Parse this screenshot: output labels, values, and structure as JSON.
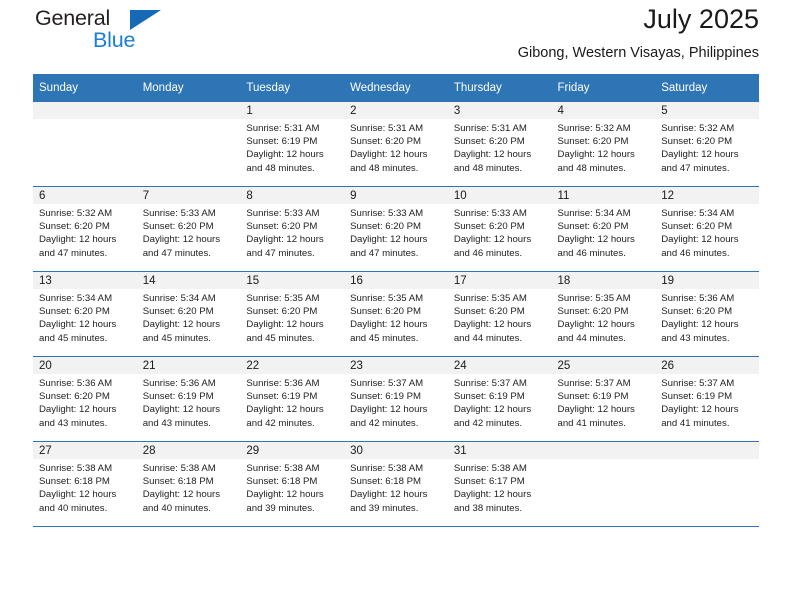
{
  "brand": {
    "name_top": "General",
    "name_bottom": "Blue",
    "triangle_icon": "triangle-icon",
    "accent_color": "#1a7fd4",
    "triangle_color": "#1669b5"
  },
  "header": {
    "title": "July 2025",
    "subtitle": "Gibong, Western Visayas, Philippines"
  },
  "theme": {
    "header_blue": "#2e75b6",
    "daynum_band": "#f2f2f2",
    "text": "#1a1a1a"
  },
  "weekday_headers": [
    "Sunday",
    "Monday",
    "Tuesday",
    "Wednesday",
    "Thursday",
    "Friday",
    "Saturday"
  ],
  "weeks": [
    [
      {
        "day": "",
        "sunrise": "",
        "sunset": "",
        "daylight_1": "",
        "daylight_2": ""
      },
      {
        "day": "",
        "sunrise": "",
        "sunset": "",
        "daylight_1": "",
        "daylight_2": ""
      },
      {
        "day": "1",
        "sunrise": "Sunrise: 5:31 AM",
        "sunset": "Sunset: 6:19 PM",
        "daylight_1": "Daylight: 12 hours",
        "daylight_2": "and 48 minutes."
      },
      {
        "day": "2",
        "sunrise": "Sunrise: 5:31 AM",
        "sunset": "Sunset: 6:20 PM",
        "daylight_1": "Daylight: 12 hours",
        "daylight_2": "and 48 minutes."
      },
      {
        "day": "3",
        "sunrise": "Sunrise: 5:31 AM",
        "sunset": "Sunset: 6:20 PM",
        "daylight_1": "Daylight: 12 hours",
        "daylight_2": "and 48 minutes."
      },
      {
        "day": "4",
        "sunrise": "Sunrise: 5:32 AM",
        "sunset": "Sunset: 6:20 PM",
        "daylight_1": "Daylight: 12 hours",
        "daylight_2": "and 48 minutes."
      },
      {
        "day": "5",
        "sunrise": "Sunrise: 5:32 AM",
        "sunset": "Sunset: 6:20 PM",
        "daylight_1": "Daylight: 12 hours",
        "daylight_2": "and 47 minutes."
      }
    ],
    [
      {
        "day": "6",
        "sunrise": "Sunrise: 5:32 AM",
        "sunset": "Sunset: 6:20 PM",
        "daylight_1": "Daylight: 12 hours",
        "daylight_2": "and 47 minutes."
      },
      {
        "day": "7",
        "sunrise": "Sunrise: 5:33 AM",
        "sunset": "Sunset: 6:20 PM",
        "daylight_1": "Daylight: 12 hours",
        "daylight_2": "and 47 minutes."
      },
      {
        "day": "8",
        "sunrise": "Sunrise: 5:33 AM",
        "sunset": "Sunset: 6:20 PM",
        "daylight_1": "Daylight: 12 hours",
        "daylight_2": "and 47 minutes."
      },
      {
        "day": "9",
        "sunrise": "Sunrise: 5:33 AM",
        "sunset": "Sunset: 6:20 PM",
        "daylight_1": "Daylight: 12 hours",
        "daylight_2": "and 47 minutes."
      },
      {
        "day": "10",
        "sunrise": "Sunrise: 5:33 AM",
        "sunset": "Sunset: 6:20 PM",
        "daylight_1": "Daylight: 12 hours",
        "daylight_2": "and 46 minutes."
      },
      {
        "day": "11",
        "sunrise": "Sunrise: 5:34 AM",
        "sunset": "Sunset: 6:20 PM",
        "daylight_1": "Daylight: 12 hours",
        "daylight_2": "and 46 minutes."
      },
      {
        "day": "12",
        "sunrise": "Sunrise: 5:34 AM",
        "sunset": "Sunset: 6:20 PM",
        "daylight_1": "Daylight: 12 hours",
        "daylight_2": "and 46 minutes."
      }
    ],
    [
      {
        "day": "13",
        "sunrise": "Sunrise: 5:34 AM",
        "sunset": "Sunset: 6:20 PM",
        "daylight_1": "Daylight: 12 hours",
        "daylight_2": "and 45 minutes."
      },
      {
        "day": "14",
        "sunrise": "Sunrise: 5:34 AM",
        "sunset": "Sunset: 6:20 PM",
        "daylight_1": "Daylight: 12 hours",
        "daylight_2": "and 45 minutes."
      },
      {
        "day": "15",
        "sunrise": "Sunrise: 5:35 AM",
        "sunset": "Sunset: 6:20 PM",
        "daylight_1": "Daylight: 12 hours",
        "daylight_2": "and 45 minutes."
      },
      {
        "day": "16",
        "sunrise": "Sunrise: 5:35 AM",
        "sunset": "Sunset: 6:20 PM",
        "daylight_1": "Daylight: 12 hours",
        "daylight_2": "and 45 minutes."
      },
      {
        "day": "17",
        "sunrise": "Sunrise: 5:35 AM",
        "sunset": "Sunset: 6:20 PM",
        "daylight_1": "Daylight: 12 hours",
        "daylight_2": "and 44 minutes."
      },
      {
        "day": "18",
        "sunrise": "Sunrise: 5:35 AM",
        "sunset": "Sunset: 6:20 PM",
        "daylight_1": "Daylight: 12 hours",
        "daylight_2": "and 44 minutes."
      },
      {
        "day": "19",
        "sunrise": "Sunrise: 5:36 AM",
        "sunset": "Sunset: 6:20 PM",
        "daylight_1": "Daylight: 12 hours",
        "daylight_2": "and 43 minutes."
      }
    ],
    [
      {
        "day": "20",
        "sunrise": "Sunrise: 5:36 AM",
        "sunset": "Sunset: 6:20 PM",
        "daylight_1": "Daylight: 12 hours",
        "daylight_2": "and 43 minutes."
      },
      {
        "day": "21",
        "sunrise": "Sunrise: 5:36 AM",
        "sunset": "Sunset: 6:19 PM",
        "daylight_1": "Daylight: 12 hours",
        "daylight_2": "and 43 minutes."
      },
      {
        "day": "22",
        "sunrise": "Sunrise: 5:36 AM",
        "sunset": "Sunset: 6:19 PM",
        "daylight_1": "Daylight: 12 hours",
        "daylight_2": "and 42 minutes."
      },
      {
        "day": "23",
        "sunrise": "Sunrise: 5:37 AM",
        "sunset": "Sunset: 6:19 PM",
        "daylight_1": "Daylight: 12 hours",
        "daylight_2": "and 42 minutes."
      },
      {
        "day": "24",
        "sunrise": "Sunrise: 5:37 AM",
        "sunset": "Sunset: 6:19 PM",
        "daylight_1": "Daylight: 12 hours",
        "daylight_2": "and 42 minutes."
      },
      {
        "day": "25",
        "sunrise": "Sunrise: 5:37 AM",
        "sunset": "Sunset: 6:19 PM",
        "daylight_1": "Daylight: 12 hours",
        "daylight_2": "and 41 minutes."
      },
      {
        "day": "26",
        "sunrise": "Sunrise: 5:37 AM",
        "sunset": "Sunset: 6:19 PM",
        "daylight_1": "Daylight: 12 hours",
        "daylight_2": "and 41 minutes."
      }
    ],
    [
      {
        "day": "27",
        "sunrise": "Sunrise: 5:38 AM",
        "sunset": "Sunset: 6:18 PM",
        "daylight_1": "Daylight: 12 hours",
        "daylight_2": "and 40 minutes."
      },
      {
        "day": "28",
        "sunrise": "Sunrise: 5:38 AM",
        "sunset": "Sunset: 6:18 PM",
        "daylight_1": "Daylight: 12 hours",
        "daylight_2": "and 40 minutes."
      },
      {
        "day": "29",
        "sunrise": "Sunrise: 5:38 AM",
        "sunset": "Sunset: 6:18 PM",
        "daylight_1": "Daylight: 12 hours",
        "daylight_2": "and 39 minutes."
      },
      {
        "day": "30",
        "sunrise": "Sunrise: 5:38 AM",
        "sunset": "Sunset: 6:18 PM",
        "daylight_1": "Daylight: 12 hours",
        "daylight_2": "and 39 minutes."
      },
      {
        "day": "31",
        "sunrise": "Sunrise: 5:38 AM",
        "sunset": "Sunset: 6:17 PM",
        "daylight_1": "Daylight: 12 hours",
        "daylight_2": "and 38 minutes."
      },
      {
        "day": "",
        "sunrise": "",
        "sunset": "",
        "daylight_1": "",
        "daylight_2": ""
      },
      {
        "day": "",
        "sunrise": "",
        "sunset": "",
        "daylight_1": "",
        "daylight_2": ""
      }
    ]
  ]
}
